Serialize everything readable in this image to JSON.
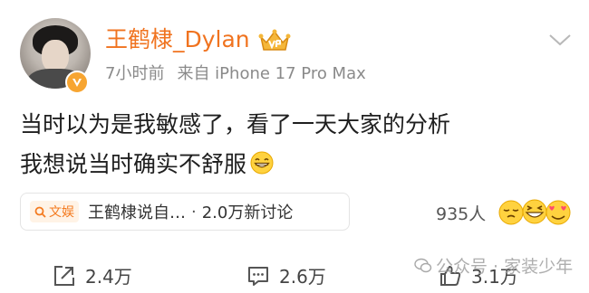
{
  "post": {
    "author": {
      "name": "王鹤棣_Dylan",
      "avatar_icon": "avatar-photo",
      "badge_icon": "verified-v-badge",
      "vip_icon": "vip-crown-icon",
      "name_color": "#f0731f"
    },
    "meta": {
      "time": "7小时前",
      "source": "来自 iPhone 17 Pro Max"
    },
    "content": {
      "line1": "当时以为是我敏感了，看了一天大家的分析",
      "line2": "我想说当时确实不舒服",
      "emoji": "grinning-face"
    },
    "topic": {
      "tag": "文娱",
      "title": "王鹤棣说自…",
      "dot": "·",
      "discussion": "2.0万新讨论"
    },
    "reactions": {
      "count": "935人",
      "emojis": [
        "sleepy-face",
        "grinning-squint-face",
        "heart-eyes-face"
      ]
    },
    "actions": {
      "repost": "2.4万",
      "comment": "2.6万",
      "like": "3.1万"
    },
    "watermark": {
      "text": "公众号 · 家装少年"
    },
    "colors": {
      "accent": "#f47b20",
      "text": "#1f1f1f",
      "muted": "#8a8a8a"
    }
  }
}
